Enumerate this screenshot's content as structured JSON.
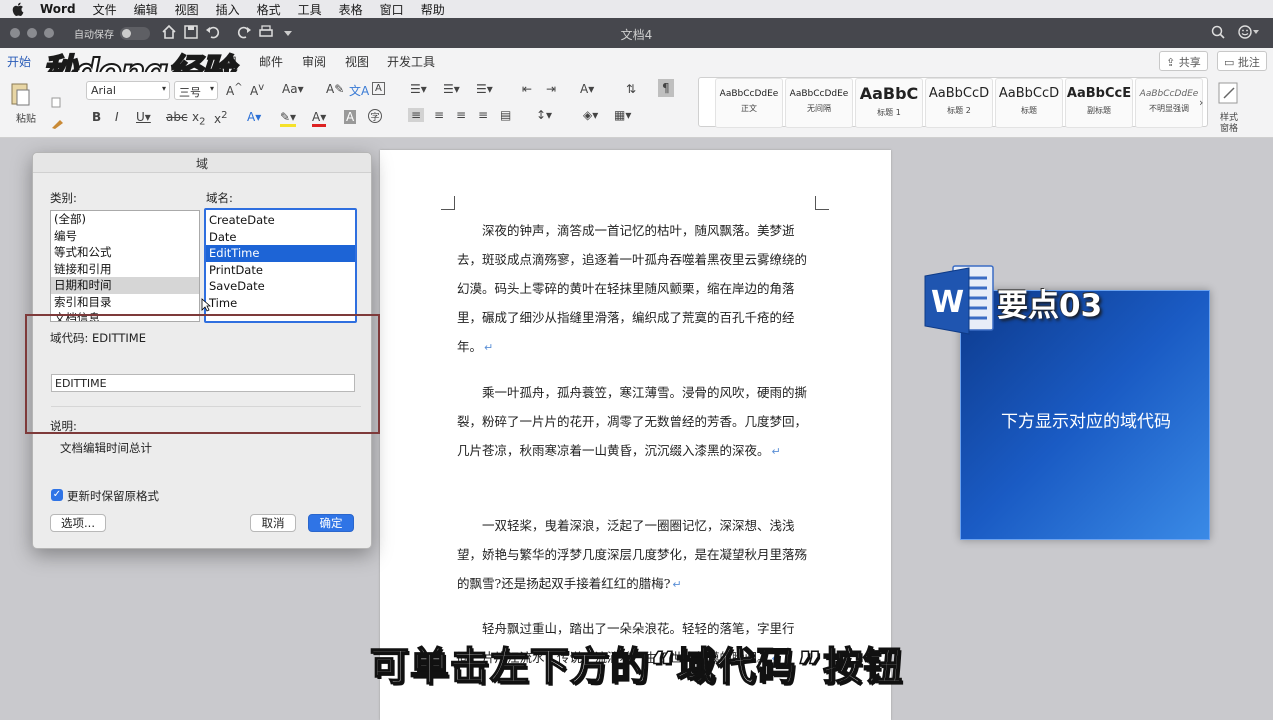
{
  "menubar": {
    "app": "Word",
    "items": [
      "文件",
      "编辑",
      "视图",
      "插入",
      "格式",
      "工具",
      "表格",
      "窗口",
      "帮助"
    ]
  },
  "titlebar": {
    "autosave": "自动保存",
    "title": "文档4"
  },
  "ribbon_tabs": {
    "home": "开始",
    "mailings_tail": "用",
    "mail": "邮件",
    "review": "审阅",
    "view": "视图",
    "dev": "开发工具",
    "share": "共享",
    "comments": "批注"
  },
  "watermark_logo": "秒dong经验",
  "ribbon": {
    "paste": "粘贴",
    "font": "Arial",
    "size": "三号",
    "styles": [
      {
        "sample": "AaBbCcDdEe",
        "name": "正文"
      },
      {
        "sample": "AaBbCcDdEe",
        "name": "无间隔"
      },
      {
        "sample": "AaBbC",
        "name": "标题 1"
      },
      {
        "sample": "AaBbCcD",
        "name": "标题 2"
      },
      {
        "sample": "AaBbCcD",
        "name": "标题"
      },
      {
        "sample": "AaBbCcE",
        "name": "副标题"
      },
      {
        "sample": "AaBbCcDdEe",
        "name": "不明显强调"
      }
    ],
    "styles_pane_line1": "样式",
    "styles_pane_line2": "窗格"
  },
  "dialog": {
    "title": "域",
    "categories_label": "类别:",
    "names_label": "域名:",
    "categories": [
      "(全部)",
      "编号",
      "等式和公式",
      "链接和引用",
      "日期和时间",
      "索引和目录",
      "文档信息"
    ],
    "categories_selected": 4,
    "field_names": [
      "CreateDate",
      "Date",
      "EditTime",
      "PrintDate",
      "SaveDate",
      "Time"
    ],
    "field_names_selected": 2,
    "field_code_label": "域代码:",
    "field_code_value": "EDITTIME",
    "field_input": "EDITTIME",
    "description_label": "说明:",
    "description": "文档编辑时间总计",
    "preserve_format": "更新时保留原格式",
    "options_btn": "选项...",
    "cancel_btn": "取消",
    "ok_btn": "确定"
  },
  "document": {
    "paragraphs": [
      "深夜的钟声，滴答成一首记忆的枯叶，随风飘落。美梦逝去，斑驳成点滴殇寥，追逐着一叶孤舟吞噬着黑夜里云雾缭绕的幻漠。码头上零碎的黄叶在轻抹里随风颤栗，缩在岸边的角落里，碾成了细沙从指缝里滑落，编织成了荒寞的百孔千疮的经年。",
      "乘一叶孤舟，孤舟蓑笠，寒江薄雪。浸骨的风吹，硬雨的撕裂，粉碎了一片片的花开，凋零了无数曾经的芳香。几度梦回，几片苍凉，秋雨寒凉着一山黄昏，沉沉缀入漆黑的深夜。",
      "一双轻桨，曳着深浪，泛起了一圈圈记忆，深深想、浅浅望，娇艳与繁华的浮梦几度深层几度梦化，是在凝望秋月里落殇的飘雪?还是扬起双手接着红红的腊梅?",
      "轻舟飘过重山，踏出了一朵朵浪花。轻轻的落笔，字里行间，片片江流水，传说，流淌着一生三世的落漠的瞬间。"
    ]
  },
  "overlay": {
    "point_title": "要点03",
    "card_text": "下方显示对应的域代码"
  },
  "subtitle": "可单击左下方的“域代码”按钮",
  "colors": {
    "accent": "#2a5cb8",
    "selection": "#1d64d6",
    "highlight_frame": "#7e3a3a",
    "card_blue": "#1a5bc4"
  }
}
